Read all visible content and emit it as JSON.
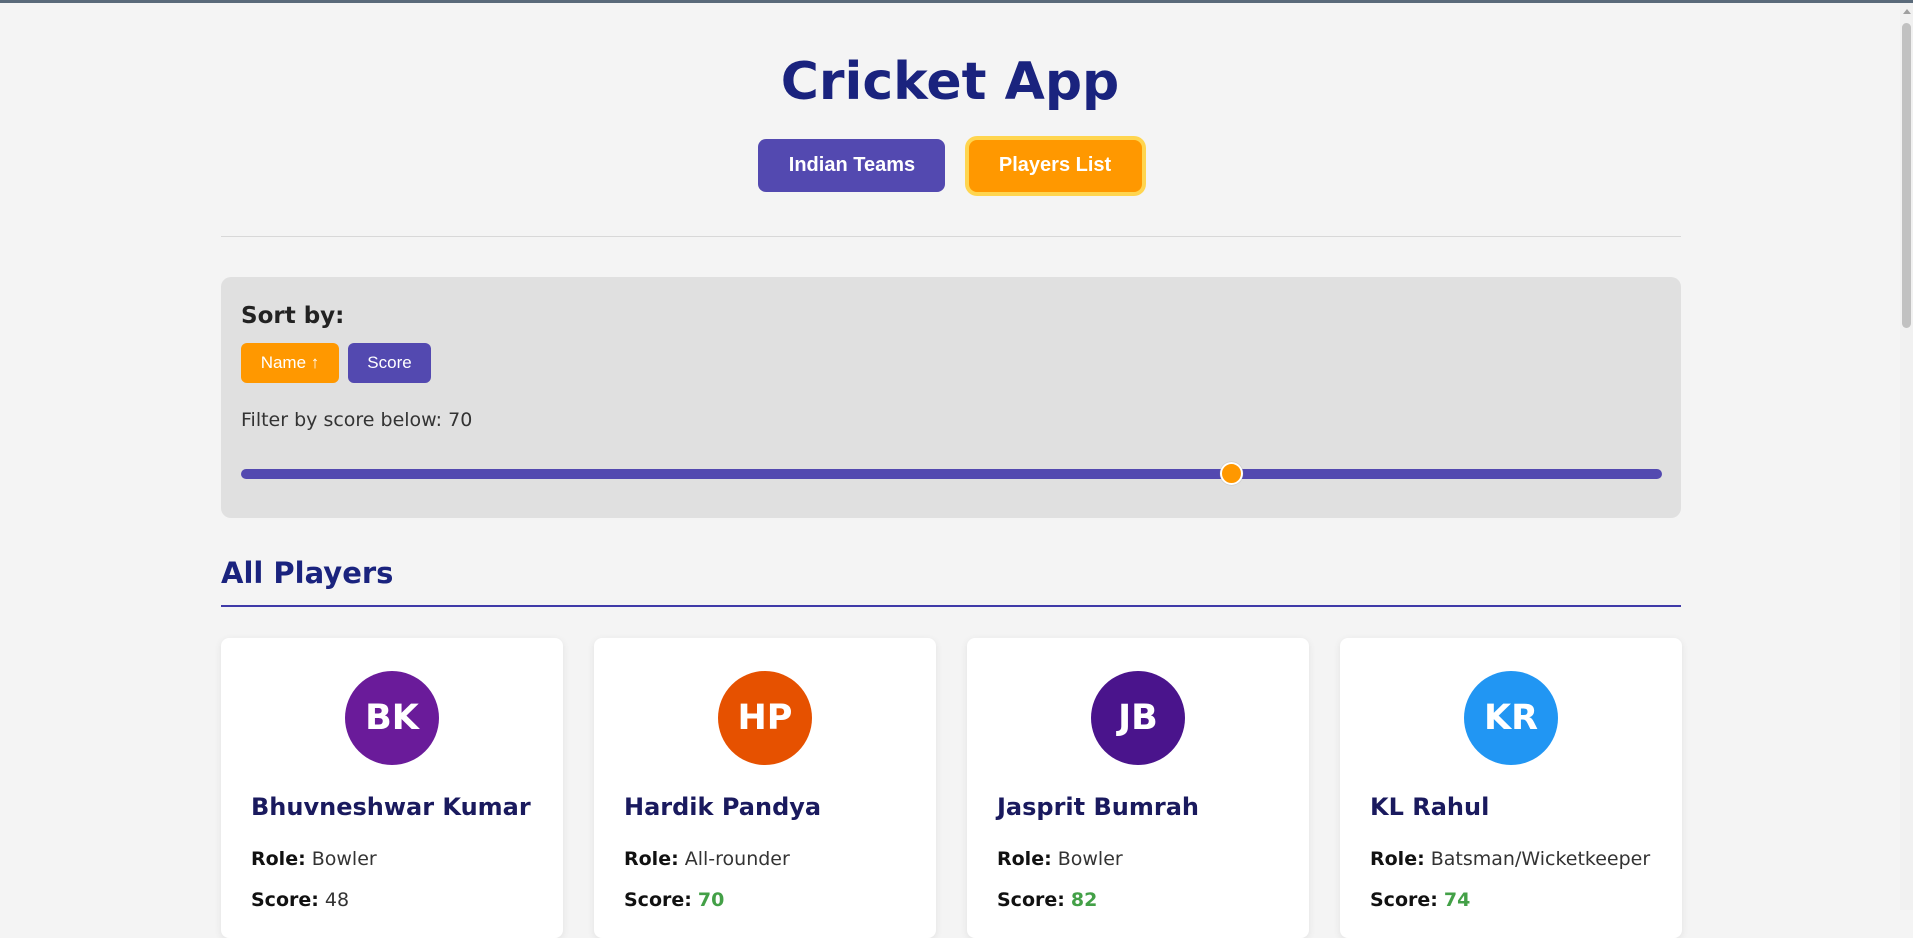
{
  "app": {
    "title": "Cricket App"
  },
  "nav": {
    "teams_label": "Indian Teams",
    "players_label": "Players List"
  },
  "controls": {
    "sort_label": "Sort by:",
    "sort_name_label": "Name ↑",
    "sort_score_label": "Score",
    "filter_label": "Filter by score below: ",
    "filter_value": "70",
    "slider": {
      "min": 0,
      "max": 100,
      "value": 70
    }
  },
  "section": {
    "title": "All Players"
  },
  "labels": {
    "role": "Role:",
    "score": "Score:"
  },
  "colors": {
    "primary": "#5349b0",
    "accent": "#ff9800",
    "title": "#1a237e",
    "score_high": "#43a047"
  },
  "players": [
    {
      "initials": "BK",
      "name": "Bhuvneshwar Kumar",
      "role": "Bowler",
      "score": "48",
      "avatar_color": "#6a1b9a",
      "score_high": false
    },
    {
      "initials": "HP",
      "name": "Hardik Pandya",
      "role": "All-rounder",
      "score": "70",
      "avatar_color": "#e65100",
      "score_high": true
    },
    {
      "initials": "JB",
      "name": "Jasprit Bumrah",
      "role": "Bowler",
      "score": "82",
      "avatar_color": "#4a148c",
      "score_high": true
    },
    {
      "initials": "KR",
      "name": "KL Rahul",
      "role": "Batsman/Wicketkeeper",
      "score": "74",
      "avatar_color": "#2196f3",
      "score_high": true
    }
  ]
}
